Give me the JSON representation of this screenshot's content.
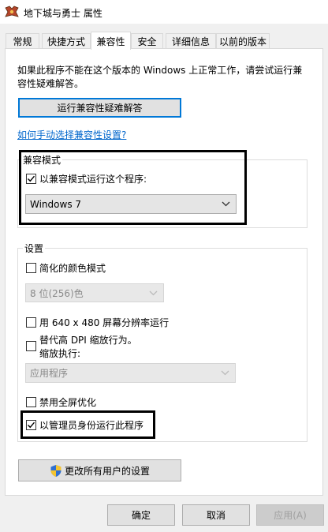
{
  "window": {
    "title": "地下城与勇士 属性"
  },
  "tabs": [
    {
      "label": "常规"
    },
    {
      "label": "快捷方式"
    },
    {
      "label": "兼容性"
    },
    {
      "label": "安全"
    },
    {
      "label": "详细信息"
    },
    {
      "label": "以前的版本"
    }
  ],
  "compat": {
    "intro": "如果此程序不能在这个版本的 Windows 上正常工作，请尝试运行兼容性疑难解答。",
    "troubleshoot_button": "运行兼容性疑难解答",
    "manual_link": "如何手动选择兼容性设置?"
  },
  "compat_mode": {
    "legend": "兼容模式",
    "run_in_compat_label": "以兼容模式运行这个程序:",
    "run_in_compat_checked": true,
    "os_selected": "Windows 7"
  },
  "settings": {
    "legend": "设置",
    "reduced_color_label": "简化的颜色模式",
    "reduced_color_checked": false,
    "color_select": "8 位(256)色",
    "res_640_label": "用 640 x 480 屏幕分辨率运行",
    "res_640_checked": false,
    "dpi_label_line1": "替代高 DPI 缩放行为。",
    "dpi_label_line2": "缩放执行:",
    "dpi_checked": false,
    "dpi_select": "应用程序",
    "fullscreen_opt_label": "禁用全屏优化",
    "fullscreen_opt_checked": false,
    "admin_label": "以管理员身份运行此程序",
    "admin_checked": true
  },
  "all_users_button": "更改所有用户的设置",
  "footer": {
    "ok": "确定",
    "cancel": "取消",
    "apply": "应用(A)"
  }
}
